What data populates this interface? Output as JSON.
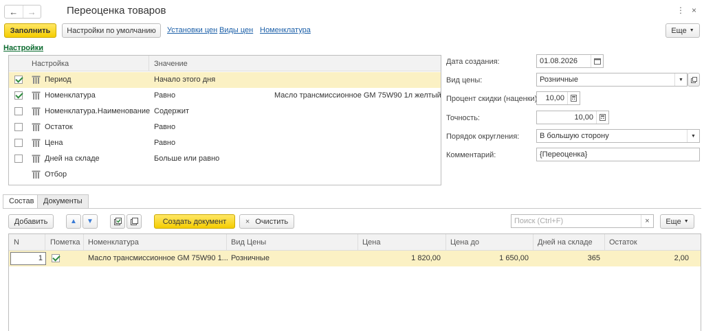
{
  "window": {
    "title": "Переоценка товаров",
    "back_icon": "←",
    "forward_icon": "→",
    "more_icon": "⋮",
    "close_icon": "×"
  },
  "toolbar": {
    "fill_label": "Заполнить",
    "defaults_label": "Настройки по умолчанию",
    "links": [
      "Установки цен",
      "Виды цен",
      "Номенклатура"
    ],
    "more_label": "Еще"
  },
  "settings": {
    "section_title": "Настройки",
    "columns": [
      "Настройка",
      "Значение"
    ],
    "rows": [
      {
        "checked": true,
        "name": "Период",
        "op": "Начало этого дня",
        "value": ""
      },
      {
        "checked": true,
        "name": "Номенклатура",
        "op": "Равно",
        "value": "Масло трансмиссионное GM 75W90 1л желтый"
      },
      {
        "checked": false,
        "name": "Номенклатура.Наименование",
        "op": "Содержит",
        "value": ""
      },
      {
        "checked": false,
        "name": "Остаток",
        "op": "Равно",
        "value": ""
      },
      {
        "checked": false,
        "name": "Цена",
        "op": "Равно",
        "value": ""
      },
      {
        "checked": false,
        "name": "Дней на складе",
        "op": "Больше или равно",
        "value": ""
      },
      {
        "checked": null,
        "name": "Отбор",
        "op": "",
        "value": ""
      }
    ]
  },
  "form": {
    "date_label": "Дата создания:",
    "date_value": "01.08.2026",
    "price_type_label": "Вид цены:",
    "price_type_value": "Розничные",
    "discount_label": "Процент скидки (наценки):",
    "discount_value": "10,00",
    "precision_label": "Точность:",
    "precision_value": "10,00",
    "rounding_label": "Порядок округления:",
    "rounding_value": "В большую сторону",
    "comment_label": "Комментарий:",
    "comment_value": "{Переоценка}"
  },
  "tabs": [
    "Состав",
    "Документы"
  ],
  "grid_toolbar": {
    "add_label": "Добавить",
    "create_doc_label": "Создать документ",
    "clear_label": "Очистить",
    "search_placeholder": "Поиск (Ctrl+F)",
    "more_label": "Еще"
  },
  "grid": {
    "columns": [
      "N",
      "Пометка",
      "Номенклатура",
      "Вид Цены",
      "Цена",
      "Цена до",
      "Дней на складе",
      "Остаток"
    ],
    "rows": [
      {
        "n": "1",
        "checked": true,
        "item": "Масло трансмиссионное GM 75W90 1...",
        "price_type": "Розничные",
        "price": "1 820,00",
        "price_to": "1 650,00",
        "days": "365",
        "stock": "2,00"
      }
    ]
  },
  "colors": {
    "accent_yellow": "#f5cd00",
    "selected_row": "#fbf1c4",
    "link_blue": "#1b5fa8",
    "section_green": "#0a6a2e"
  }
}
